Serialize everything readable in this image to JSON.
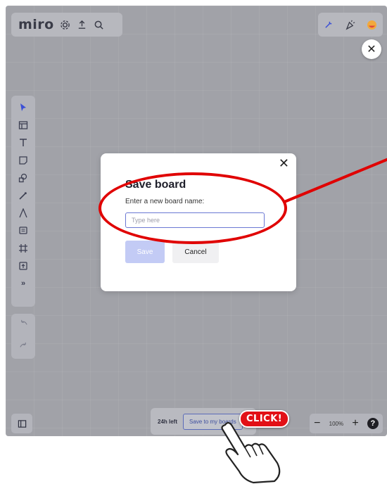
{
  "app": {
    "logo": "miro"
  },
  "toolbar": {
    "icons": [
      "settings-icon",
      "share-upload-icon",
      "search-icon"
    ]
  },
  "top_right": {
    "icons": [
      "reactions-icon",
      "celebrate-icon",
      "user-avatar"
    ]
  },
  "left_tools": [
    "cursor-icon",
    "template-icon",
    "text-icon",
    "sticky-note-icon",
    "shapes-icon",
    "pen-icon",
    "line-icon",
    "comment-icon",
    "frame-icon",
    "upload-icon",
    "more-icon"
  ],
  "dialog": {
    "title": "Save board",
    "label": "Enter a new board name:",
    "input_placeholder": "Type here",
    "input_value": "",
    "save_label": "Save",
    "cancel_label": "Cancel",
    "close_symbol": "✕"
  },
  "bottom_bar": {
    "hours_left": "24h left",
    "save_to_boards": "Save to my boards"
  },
  "zoom": {
    "level": "100%",
    "minus": "−",
    "plus": "+",
    "help": "?"
  },
  "annotation": {
    "click_badge": "CLICK!",
    "highlight_color": "#e00000"
  },
  "colors": {
    "accent": "#6b78d4",
    "save_disabled": "#c3cbf5"
  }
}
